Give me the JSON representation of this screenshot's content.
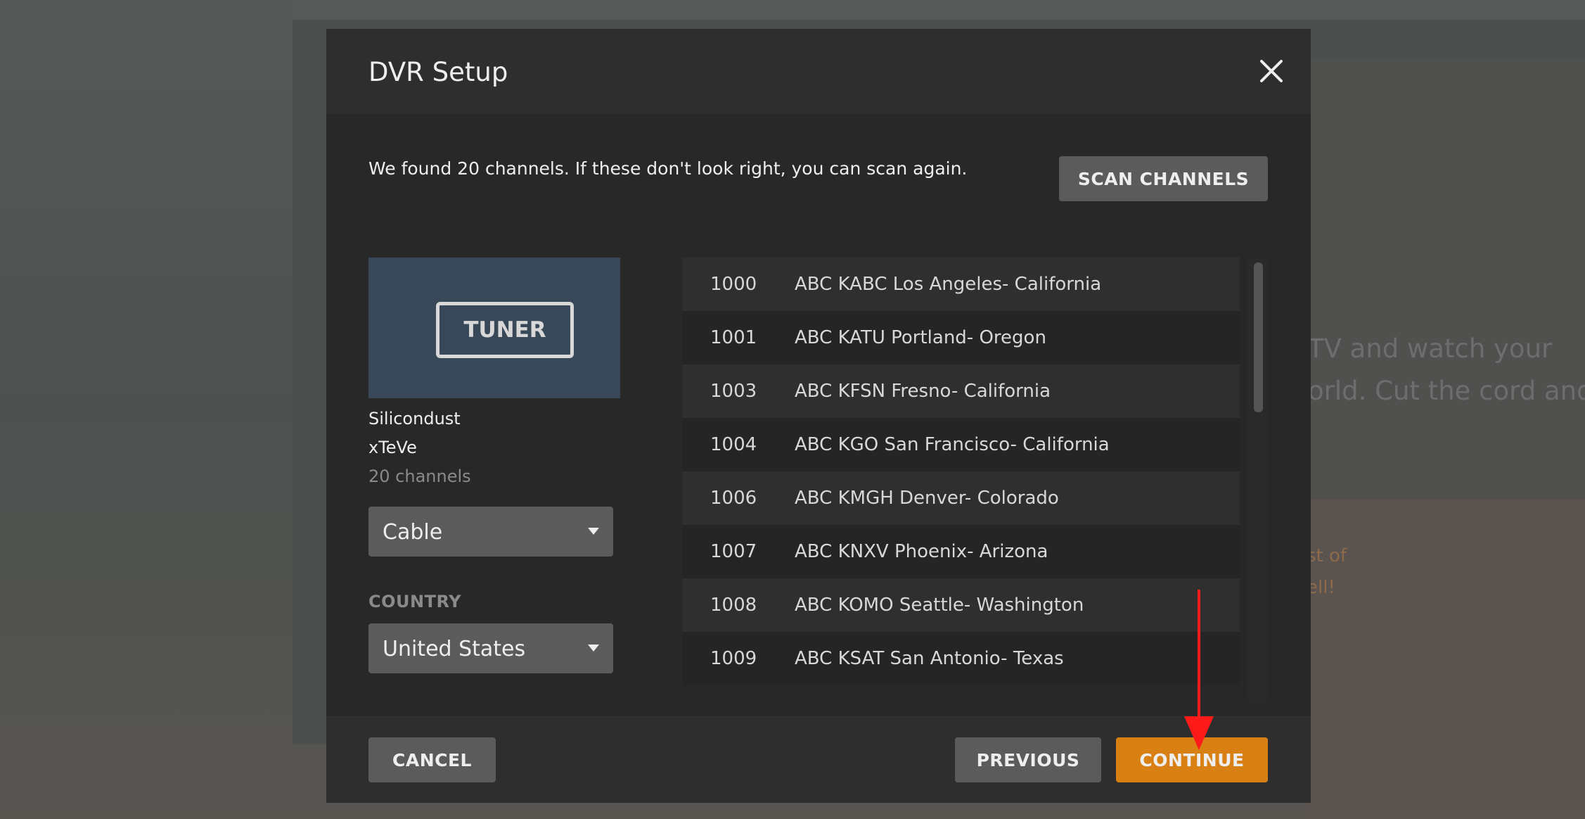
{
  "background": {
    "line1": "TV and watch your",
    "line2": "orld. Cut the cord and",
    "orange1": "st of",
    "orange2": "ell!"
  },
  "modal": {
    "title": "DVR Setup",
    "close_icon": "close-icon",
    "info_text": "We found 20 channels. If these don't look right, you can scan again.",
    "scan_label": "SCAN CHANNELS"
  },
  "device": {
    "thumb_label": "TUNER",
    "name": "Silicondust",
    "model": "xTeVe",
    "channel_count": "20 channels",
    "type_selected": "Cable",
    "country_label": "COUNTRY",
    "country_selected": "United States"
  },
  "channels": [
    {
      "number": "1000",
      "name": "ABC KABC Los Angeles- California"
    },
    {
      "number": "1001",
      "name": "ABC KATU Portland- Oregon"
    },
    {
      "number": "1003",
      "name": "ABC KFSN Fresno- California"
    },
    {
      "number": "1004",
      "name": "ABC KGO San Francisco- California"
    },
    {
      "number": "1006",
      "name": "ABC KMGH Denver- Colorado"
    },
    {
      "number": "1007",
      "name": "ABC KNXV Phoenix- Arizona"
    },
    {
      "number": "1008",
      "name": "ABC KOMO Seattle- Washington"
    },
    {
      "number": "1009",
      "name": "ABC KSAT San Antonio- Texas"
    }
  ],
  "footer": {
    "cancel_label": "CANCEL",
    "previous_label": "PREVIOUS",
    "continue_label": "CONTINUE"
  },
  "colors": {
    "accent": "#d98014",
    "annotation_arrow": "#ff0000"
  }
}
